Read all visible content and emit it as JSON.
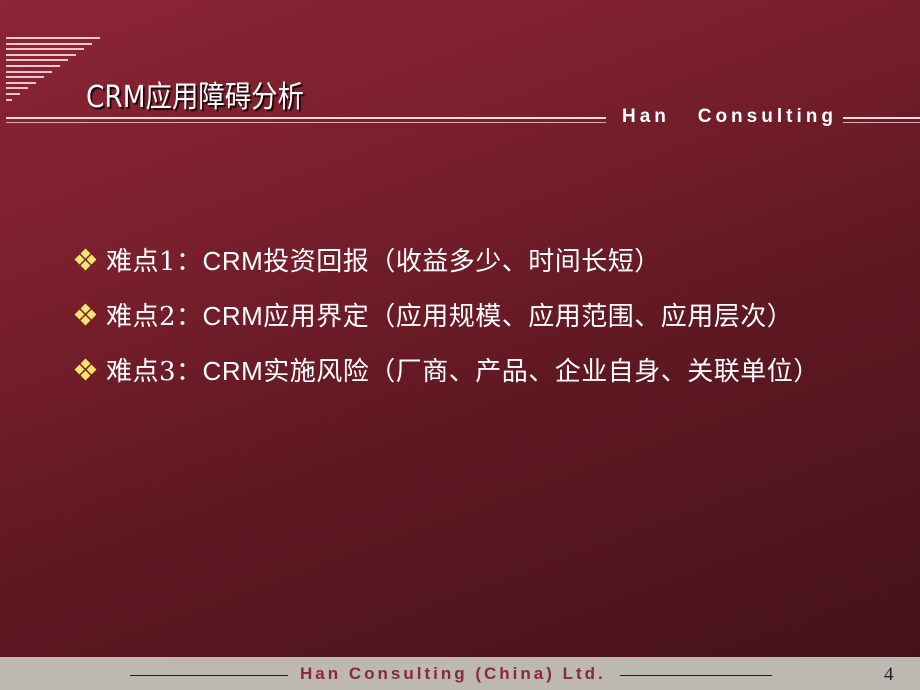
{
  "slide": {
    "title": "CRM应用障碍分析",
    "brand": "Han   Consulting",
    "bullets": [
      {
        "label": "难点1：",
        "latin": "CRM",
        "text": "投资回报（收益多少、时间长短）"
      },
      {
        "label": "难点2：",
        "latin": "CRM",
        "text": "应用界定（应用规模、应用范围、应用层次）"
      },
      {
        "label": "难点3：",
        "latin": "CRM",
        "text": "实施风险（厂商、产品、企业自身、关联单位）"
      }
    ],
    "bullet_icon": "four-diamond-bullet-icon"
  },
  "footer": {
    "company": "Han Consulting (China) Ltd.",
    "page_number": "4"
  },
  "colors": {
    "background_start": "#8c2535",
    "background_end": "#46121a",
    "bullet_icon": "#f5e46a",
    "footer_bg": "#bdb8b2",
    "footer_text": "#8a2a38"
  }
}
